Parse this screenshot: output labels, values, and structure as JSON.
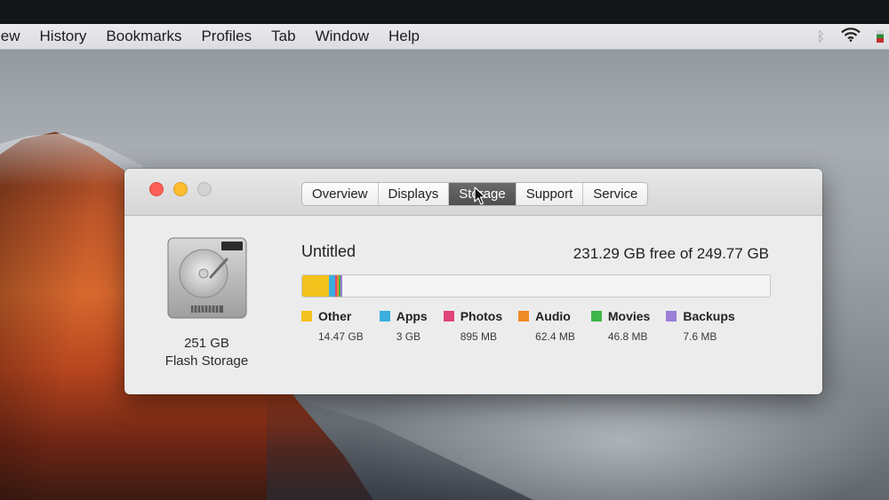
{
  "menubar": {
    "items": [
      "iew",
      "History",
      "Bookmarks",
      "Profiles",
      "Tab",
      "Window",
      "Help"
    ],
    "status_icons": [
      "bluetooth-icon",
      "wifi-icon",
      "flag-icon"
    ]
  },
  "window": {
    "tabs": [
      {
        "label": "Overview",
        "active": false
      },
      {
        "label": "Displays",
        "active": false
      },
      {
        "label": "Storage",
        "active": true
      },
      {
        "label": "Support",
        "active": false
      },
      {
        "label": "Service",
        "active": false
      }
    ],
    "disk": {
      "icon": "hard-drive-icon",
      "capacity": "251 GB",
      "type": "Flash Storage"
    },
    "volume": {
      "name": "Untitled",
      "free_text": "231.29 GB free of 249.77 GB",
      "total_gb": 249.77
    },
    "categories": [
      {
        "label": "Other",
        "size": "14.47 GB",
        "gb": 14.47,
        "color": "#f3c11b"
      },
      {
        "label": "Apps",
        "size": "3 GB",
        "gb": 3.0,
        "color": "#3aaee0"
      },
      {
        "label": "Photos",
        "size": "895 MB",
        "gb": 0.895,
        "color": "#e0447b"
      },
      {
        "label": "Audio",
        "size": "62.4 MB",
        "gb": 0.0624,
        "color": "#f08a24"
      },
      {
        "label": "Movies",
        "size": "46.8 MB",
        "gb": 0.0468,
        "color": "#3cb64a"
      },
      {
        "label": "Backups",
        "size": "7.6 MB",
        "gb": 0.0076,
        "color": "#9b7fd6"
      }
    ]
  }
}
